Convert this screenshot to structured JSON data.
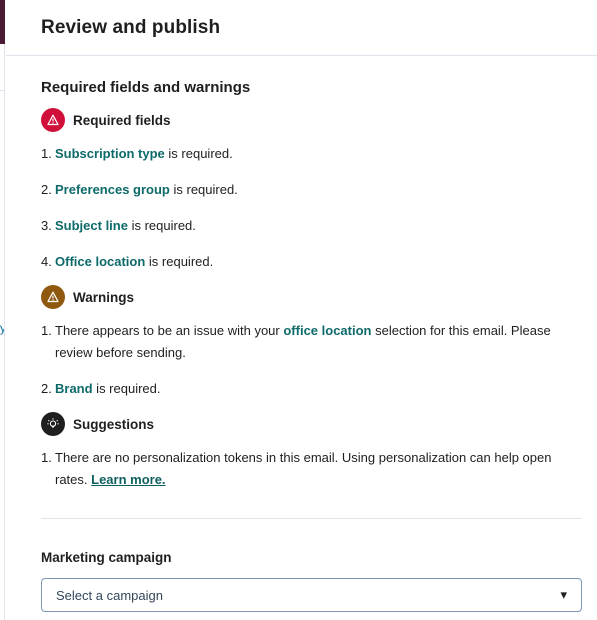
{
  "header": {
    "title": "Review and publish"
  },
  "section": {
    "title": "Required fields and warnings"
  },
  "background": {
    "link_text": "ye"
  },
  "required": {
    "title": "Required fields",
    "items": [
      {
        "num": "1.",
        "field": "Subscription type",
        "text": " is required."
      },
      {
        "num": "2.",
        "field": "Preferences group",
        "text": " is required."
      },
      {
        "num": "3.",
        "field": "Subject line",
        "text": " is required."
      },
      {
        "num": "4.",
        "field": "Office location",
        "text": " is required."
      }
    ]
  },
  "warnings": {
    "title": "Warnings",
    "items": [
      {
        "num": "1.",
        "prefix": "There appears to be an issue with your ",
        "field": "office location",
        "suffix": " selection for this email. Please review before sending."
      },
      {
        "num": "2.",
        "field": "Brand",
        "text": " is required."
      }
    ]
  },
  "suggestions": {
    "title": "Suggestions",
    "items": [
      {
        "num": "1.",
        "text": "There are no personalization tokens in this email. Using personalization can help open rates. ",
        "link": "Learn more."
      }
    ]
  },
  "campaign": {
    "label": "Marketing campaign",
    "placeholder": "Select a campaign",
    "caret": "▾"
  },
  "colors": {
    "error": "#d0103a",
    "warning": "#8f5a10",
    "suggestion": "#1f1f1f",
    "field_link": "#0e6a6a",
    "accent_strip": "#4d1a36"
  },
  "icons": {
    "required": "warning-triangle-icon",
    "warnings": "warning-triangle-icon",
    "suggestions": "lightbulb-icon",
    "campaign_select": "chevron-down-icon"
  }
}
